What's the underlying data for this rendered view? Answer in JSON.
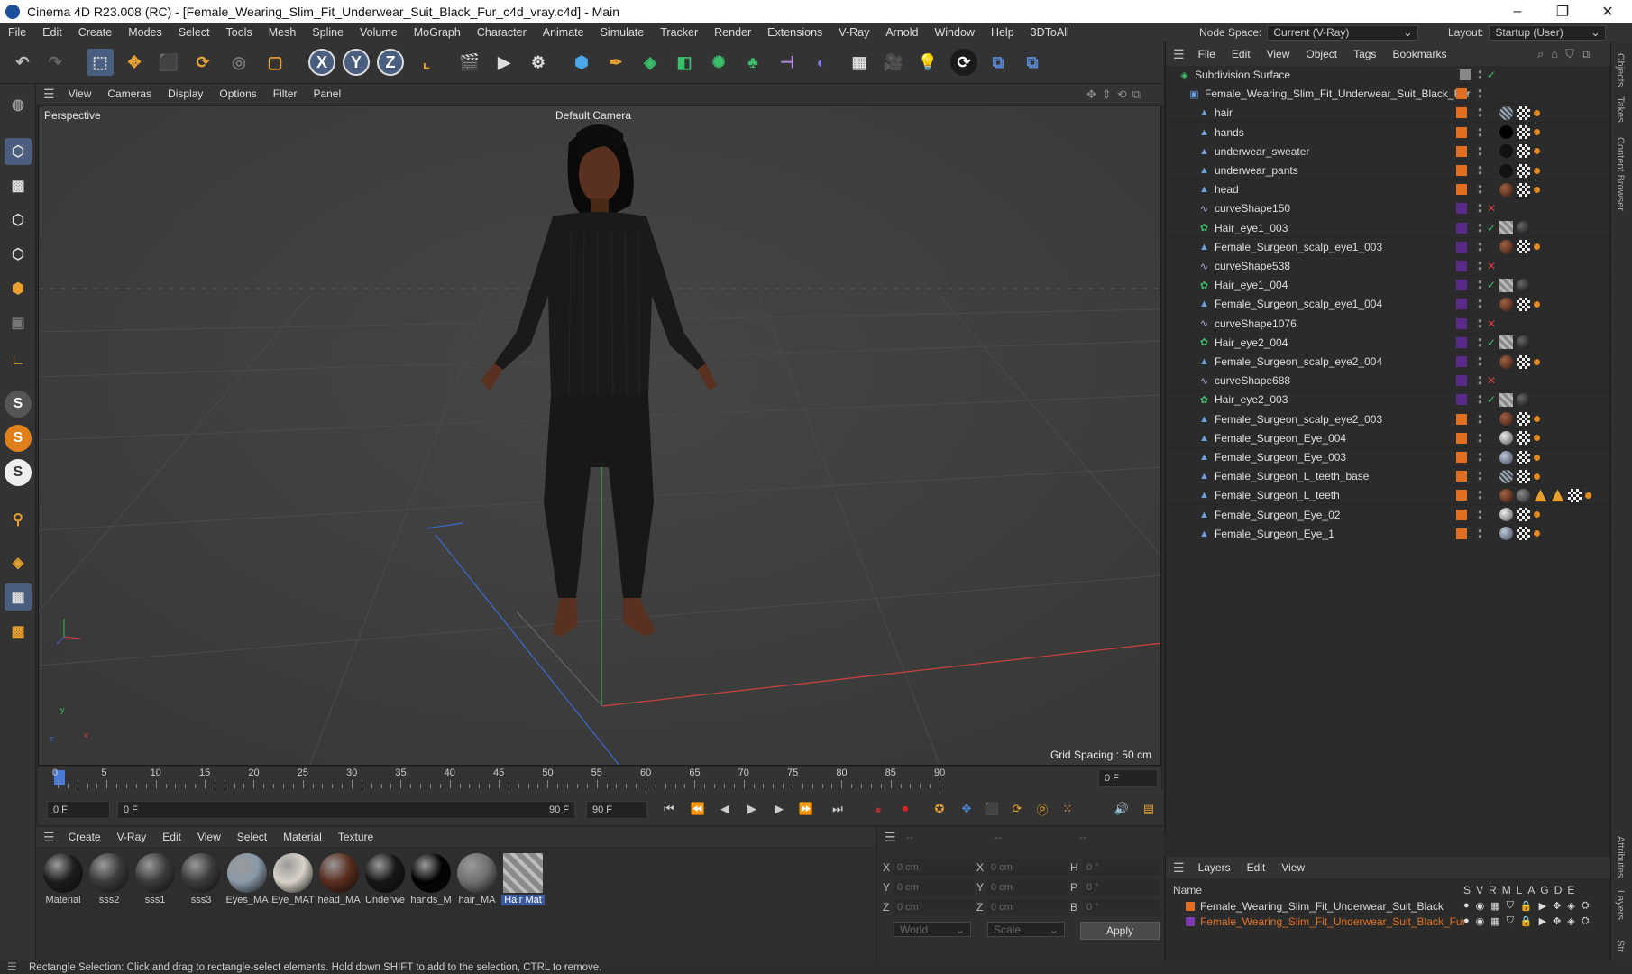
{
  "window": {
    "title": "Cinema 4D R23.008 (RC) - [Female_Wearing_Slim_Fit_Underwear_Suit_Black_Fur_c4d_vray.c4d] - Main",
    "minimize": "–",
    "maximize": "❐",
    "close": "✕"
  },
  "menubar": {
    "items": [
      "File",
      "Edit",
      "Create",
      "Modes",
      "Select",
      "Tools",
      "Mesh",
      "Spline",
      "Volume",
      "MoGraph",
      "Character",
      "Animate",
      "Simulate",
      "Tracker",
      "Render",
      "Extensions",
      "V-Ray",
      "Arnold",
      "Window",
      "Help",
      "3DToAll"
    ],
    "node_space_label": "Node Space:",
    "node_space_value": "Current (V-Ray)",
    "layout_label": "Layout:",
    "layout_value": "Startup (User)"
  },
  "toolbar": {
    "axis_x": "X",
    "axis_y": "Y",
    "axis_z": "Z"
  },
  "viewport": {
    "menu": [
      "View",
      "Cameras",
      "Display",
      "Options",
      "Filter",
      "Panel"
    ],
    "view_name": "Perspective",
    "camera": "Default Camera",
    "grid_spacing": "Grid Spacing : 50 cm",
    "axis_x": "x",
    "axis_y": "y",
    "axis_z": "z"
  },
  "timeline": {
    "ticks": [
      "0",
      "5",
      "10",
      "15",
      "20",
      "25",
      "30",
      "35",
      "40",
      "45",
      "50",
      "55",
      "60",
      "65",
      "70",
      "75",
      "80",
      "85",
      "90"
    ],
    "current_frame_field": "0 F"
  },
  "transport": {
    "start_field": "0 F",
    "range_start": "0 F",
    "range_end": "90 F",
    "end_field": "90 F"
  },
  "materials": {
    "menu": [
      "Create",
      "V-Ray",
      "Edit",
      "View",
      "Select",
      "Material",
      "Texture"
    ],
    "items": [
      {
        "label": "Material",
        "color": "#1c1c1c"
      },
      {
        "label": "sss2",
        "color": "#3a3a3a"
      },
      {
        "label": "sss1",
        "color": "#3a3a3a"
      },
      {
        "label": "sss3",
        "color": "#3a3a3a"
      },
      {
        "label": "Eyes_MA",
        "color": "#8a9aa8"
      },
      {
        "label": "Eye_MAT",
        "color": "#d8d2c8"
      },
      {
        "label": "head_MA",
        "color": "#5a2c1e"
      },
      {
        "label": "Underwe",
        "color": "#161616"
      },
      {
        "label": "hands_M",
        "color": "#020202"
      },
      {
        "label": "hair_MA",
        "color": "#707070"
      },
      {
        "label": "Hair Mat",
        "color": "#8a8a8a"
      }
    ],
    "selected": "Hair Mat"
  },
  "coords": {
    "header_dashes": [
      "--",
      "--",
      "--"
    ],
    "pos_x": "0 cm",
    "pos_y": "0 cm",
    "pos_z": "0 cm",
    "size_x": "0 cm",
    "size_y": "0 cm",
    "size_z": "0 cm",
    "rot_h": "0 °",
    "rot_p": "0 °",
    "rot_b": "0 °",
    "labels": {
      "x": "X",
      "y": "Y",
      "z": "Z",
      "h": "H",
      "p": "P",
      "b": "B"
    },
    "mode": "World",
    "size_mode": "Scale",
    "apply": "Apply"
  },
  "objects": {
    "menu": [
      "File",
      "Edit",
      "View",
      "Object",
      "Tags",
      "Bookmarks"
    ],
    "rows": [
      {
        "name": "Subdivision Surface",
        "indent": 0,
        "icon": "subdiv",
        "color": "#888888",
        "check": "✓",
        "tags": []
      },
      {
        "name": "Female_Wearing_Slim_Fit_Underwear_Suit_Black_Fur",
        "indent": 1,
        "icon": "null",
        "color": "#e07020",
        "check": "",
        "tags": []
      },
      {
        "name": "hair",
        "indent": 2,
        "icon": "mesh",
        "color": "#e07020",
        "check": "",
        "tags": [
          "net",
          "check",
          "dot"
        ]
      },
      {
        "name": "hands",
        "indent": 2,
        "icon": "mesh",
        "color": "#e07020",
        "check": "",
        "tags": [
          "black",
          "check",
          "dot"
        ]
      },
      {
        "name": "underwear_sweater",
        "indent": 2,
        "icon": "mesh",
        "color": "#e07020",
        "check": "",
        "tags": [
          "dark",
          "check",
          "dot"
        ]
      },
      {
        "name": "underwear_pants",
        "indent": 2,
        "icon": "mesh",
        "color": "#e07020",
        "check": "",
        "tags": [
          "dark",
          "check",
          "dot"
        ]
      },
      {
        "name": "head",
        "indent": 2,
        "icon": "mesh",
        "color": "#e07020",
        "check": "",
        "tags": [
          "brown",
          "check",
          "dot"
        ]
      },
      {
        "name": "curveShape150",
        "indent": 2,
        "icon": "spline",
        "color": "#5a2a8a",
        "check": "✕",
        "tags": []
      },
      {
        "name": "Hair_eye1_003",
        "indent": 2,
        "icon": "hair",
        "color": "#5a2a8a",
        "check": "✓",
        "tags": [
          "stripe",
          "darkball"
        ]
      },
      {
        "name": "Female_Surgeon_scalp_eye1_003",
        "indent": 2,
        "icon": "mesh",
        "color": "#5a2a8a",
        "check": "",
        "tags": [
          "brown",
          "check",
          "dot"
        ]
      },
      {
        "name": "curveShape538",
        "indent": 2,
        "icon": "spline",
        "color": "#5a2a8a",
        "check": "✕",
        "tags": []
      },
      {
        "name": "Hair_eye1_004",
        "indent": 2,
        "icon": "hair",
        "color": "#5a2a8a",
        "check": "✓",
        "tags": [
          "stripe",
          "darkball"
        ]
      },
      {
        "name": "Female_Surgeon_scalp_eye1_004",
        "indent": 2,
        "icon": "mesh",
        "color": "#5a2a8a",
        "check": "",
        "tags": [
          "brown",
          "check",
          "dot"
        ]
      },
      {
        "name": "curveShape1076",
        "indent": 2,
        "icon": "spline",
        "color": "#5a2a8a",
        "check": "✕",
        "tags": []
      },
      {
        "name": "Hair_eye2_004",
        "indent": 2,
        "icon": "hair",
        "color": "#5a2a8a",
        "check": "✓",
        "tags": [
          "stripe",
          "darkball"
        ]
      },
      {
        "name": "Female_Surgeon_scalp_eye2_004",
        "indent": 2,
        "icon": "mesh",
        "color": "#5a2a8a",
        "check": "",
        "tags": [
          "brown",
          "check",
          "dot"
        ]
      },
      {
        "name": "curveShape688",
        "indent": 2,
        "icon": "spline",
        "color": "#5a2a8a",
        "check": "✕",
        "tags": []
      },
      {
        "name": "Hair_eye2_003",
        "indent": 2,
        "icon": "hair",
        "color": "#5a2a8a",
        "check": "✓",
        "tags": [
          "stripe",
          "darkball"
        ]
      },
      {
        "name": "Female_Surgeon_scalp_eye2_003",
        "indent": 2,
        "icon": "mesh",
        "color": "#e07020",
        "check": "",
        "tags": [
          "brown",
          "check",
          "dot"
        ]
      },
      {
        "name": "Female_Surgeon_Eye_004",
        "indent": 2,
        "icon": "mesh",
        "color": "#e07020",
        "check": "",
        "tags": [
          "eye",
          "check",
          "dot"
        ]
      },
      {
        "name": "Female_Surgeon_Eye_003",
        "indent": 2,
        "icon": "mesh",
        "color": "#e07020",
        "check": "",
        "tags": [
          "eyeblue",
          "check",
          "dot"
        ]
      },
      {
        "name": "Female_Surgeon_L_teeth_base",
        "indent": 2,
        "icon": "mesh",
        "color": "#e07020",
        "check": "",
        "tags": [
          "net",
          "check",
          "dot"
        ]
      },
      {
        "name": "Female_Surgeon_L_teeth",
        "indent": 2,
        "icon": "mesh",
        "color": "#e07020",
        "check": "",
        "tags": [
          "brown",
          "grey",
          "tri",
          "tri",
          "check",
          "dot"
        ]
      },
      {
        "name": "Female_Surgeon_Eye_02",
        "indent": 2,
        "icon": "mesh",
        "color": "#e07020",
        "check": "",
        "tags": [
          "eye",
          "check",
          "dot"
        ]
      },
      {
        "name": "Female_Surgeon_Eye_1",
        "indent": 2,
        "icon": "mesh",
        "color": "#e07020",
        "check": "",
        "tags": [
          "eyeblue",
          "check",
          "dot"
        ]
      }
    ]
  },
  "layers": {
    "menu": [
      "Layers",
      "Edit",
      "View"
    ],
    "name_header": "Name",
    "col_headers": [
      "S",
      "V",
      "R",
      "M",
      "L",
      "A",
      "G",
      "D",
      "E"
    ],
    "rows": [
      {
        "name": "Female_Wearing_Slim_Fit_Underwear_Suit_Black",
        "color": "#e07020",
        "text_color": "#d8d8d8"
      },
      {
        "name": "Female_Wearing_Slim_Fit_Underwear_Suit_Black_Fur",
        "color": "#7a3ab0",
        "text_color": "#e07020"
      }
    ]
  },
  "sidetabs": [
    "Objects",
    "Takes",
    "Content Browser",
    "Attributes",
    "Layers",
    "Str"
  ],
  "status": "Rectangle Selection: Click and drag to rectangle-select elements. Hold down SHIFT to add to the selection, CTRL to remove."
}
